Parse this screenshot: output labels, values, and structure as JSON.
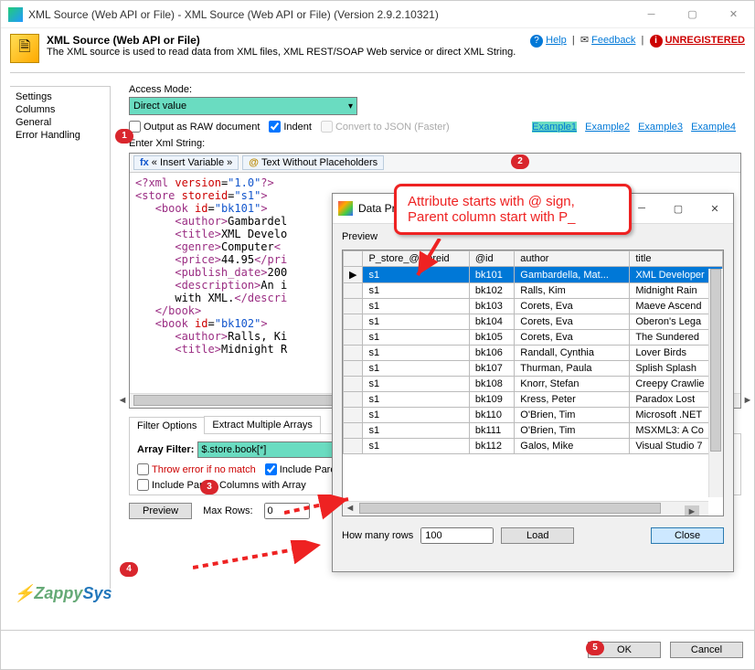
{
  "window": {
    "title": "XML Source (Web API or File) - XML Source (Web API or File) (Version 2.9.2.10321)"
  },
  "header": {
    "title": "XML Source (Web API or File)",
    "subtitle": "The XML source is used to read data from XML files, XML REST/SOAP Web service or direct XML String.",
    "help": "Help",
    "feedback": "Feedback",
    "unregistered": "UNREGISTERED"
  },
  "sidebar": {
    "items": [
      "Settings",
      "Columns",
      "General",
      "Error Handling"
    ]
  },
  "form": {
    "access_mode_label": "Access Mode:",
    "access_mode_value": "Direct value",
    "output_raw": "Output as RAW document",
    "indent": "Indent",
    "convert_json": "Convert to JSON (Faster)",
    "enter_xml_label": "Enter Xml String:",
    "insert_var": "« Insert Variable »",
    "text_no_pl": "Text Without Placeholders"
  },
  "examples": {
    "e1": "Example1",
    "e2": "Example2",
    "e3": "Example3",
    "e4": "Example4"
  },
  "tabs": {
    "filter": "Filter Options",
    "extract": "Extract Multiple Arrays"
  },
  "filter": {
    "array_filter_label": "Array Filter:",
    "array_filter_value": "$.store.book[*]",
    "throw_error": "Throw error if no match",
    "include_parent_listed": "Include Parent Columns (listed)",
    "include_parent_array": "Include Parent Columns with Array"
  },
  "buttons": {
    "preview": "Preview",
    "max_rows_label": "Max Rows:",
    "max_rows_value": "0",
    "ok": "OK",
    "cancel": "Cancel"
  },
  "callout": {
    "line1": "Attribute starts with @ sign,",
    "line2": "Parent column start with P_"
  },
  "preview": {
    "title": "Data Preview",
    "section": "Preview",
    "columns": [
      "P_store_@storeid",
      "@id",
      "author",
      "title"
    ],
    "rows": [
      [
        "s1",
        "bk101",
        "Gambardella, Mat...",
        "XML Developer"
      ],
      [
        "s1",
        "bk102",
        "Ralls, Kim",
        "Midnight Rain"
      ],
      [
        "s1",
        "bk103",
        "Corets, Eva",
        "Maeve Ascend"
      ],
      [
        "s1",
        "bk104",
        "Corets, Eva",
        "Oberon's Lega"
      ],
      [
        "s1",
        "bk105",
        "Corets, Eva",
        "The Sundered"
      ],
      [
        "s1",
        "bk106",
        "Randall, Cynthia",
        "Lover Birds"
      ],
      [
        "s1",
        "bk107",
        "Thurman, Paula",
        "Splish Splash"
      ],
      [
        "s1",
        "bk108",
        "Knorr, Stefan",
        "Creepy Crawlie"
      ],
      [
        "s1",
        "bk109",
        "Kress, Peter",
        "Paradox Lost"
      ],
      [
        "s1",
        "bk110",
        "O'Brien, Tim",
        "Microsoft .NET"
      ],
      [
        "s1",
        "bk111",
        "O'Brien, Tim",
        "MSXML3: A Co"
      ],
      [
        "s1",
        "bk112",
        "Galos, Mike",
        "Visual Studio 7"
      ]
    ],
    "how_many_label": "How many rows",
    "how_many_value": "100",
    "load": "Load",
    "close": "Close"
  },
  "brand": {
    "zappy": "Zappy",
    "sys": "Sys"
  },
  "steps": {
    "s1": "1",
    "s2": "2",
    "s3": "3",
    "s4": "4",
    "s5": "5"
  }
}
